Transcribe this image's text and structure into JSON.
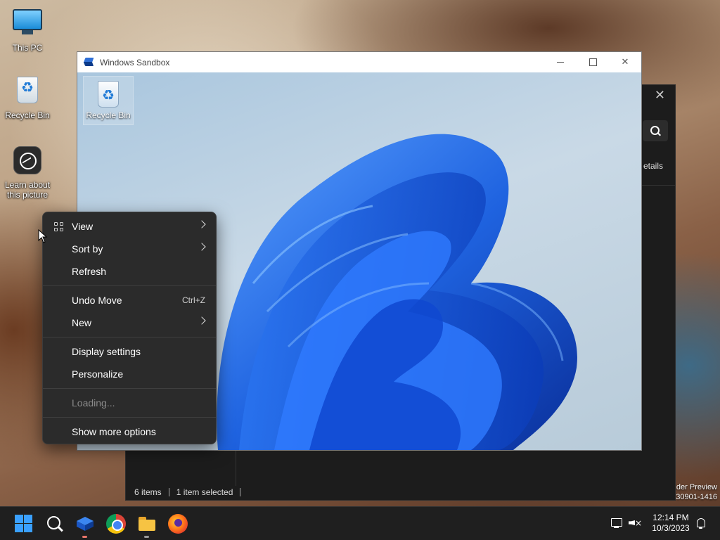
{
  "desktop": {
    "icons": [
      {
        "label": "This PC"
      },
      {
        "label": "Recycle Bin"
      },
      {
        "label": "Learn about this picture"
      }
    ]
  },
  "background_window": {
    "close_glyph": "✕",
    "details_label": "etails",
    "status": {
      "items": "6 items",
      "selected": "1 item selected"
    }
  },
  "sandbox": {
    "title": "Windows Sandbox",
    "desktop_icon_label": "Recycle Bin",
    "controls": {
      "close_glyph": "✕"
    }
  },
  "context_menu": {
    "items": [
      {
        "label": "View",
        "submenu": true,
        "icon": "view-grid-icon"
      },
      {
        "label": "Sort by",
        "submenu": true
      },
      {
        "label": "Refresh"
      },
      {
        "label": "Undo Move",
        "shortcut": "Ctrl+Z"
      },
      {
        "label": "New",
        "submenu": true
      },
      {
        "label": "Display settings"
      },
      {
        "label": "Personalize"
      },
      {
        "label": "Loading...",
        "disabled": true
      },
      {
        "label": "Show more options"
      }
    ]
  },
  "watermark": {
    "line1": "der Preview",
    "line2": "30901-1416"
  },
  "taskbar": {
    "apps": [
      "start-icon",
      "search-icon",
      "windows-sandbox-icon",
      "chrome-icon",
      "file-explorer-icon",
      "firefox-icon"
    ],
    "clock": {
      "time": "12:14 PM",
      "date": "10/3/2023"
    }
  },
  "colors": {
    "accent": "#3aa0ff",
    "menu_bg": "#2b2b2b",
    "taskbar_bg": "#1f1f1f"
  }
}
